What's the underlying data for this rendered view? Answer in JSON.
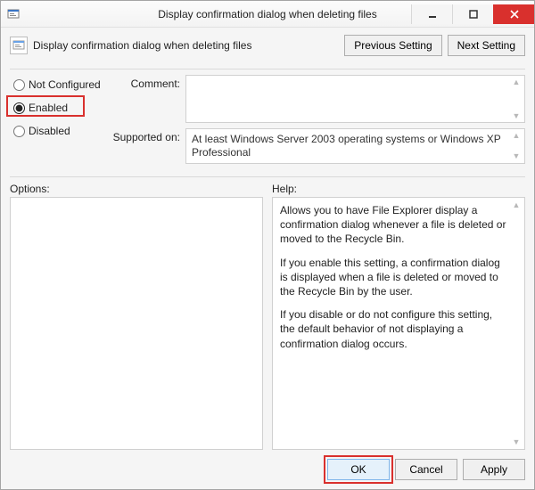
{
  "window": {
    "title": "Display confirmation dialog when deleting files"
  },
  "header": {
    "subtitle": "Display confirmation dialog when deleting files",
    "prev": "Previous Setting",
    "next": "Next Setting"
  },
  "radio": {
    "not_configured": "Not Configured",
    "enabled": "Enabled",
    "disabled": "Disabled",
    "selected": "enabled"
  },
  "fields": {
    "comment_label": "Comment:",
    "comment_value": "",
    "supported_label": "Supported on:",
    "supported_value": "At least Windows Server 2003 operating systems or Windows XP Professional"
  },
  "panes": {
    "options_label": "Options:",
    "help_label": "Help:",
    "help_p1": "Allows you to have File Explorer display a confirmation dialog whenever a file is deleted or moved to the Recycle Bin.",
    "help_p2": "If you enable this setting, a confirmation dialog is displayed when a file is deleted or moved to the Recycle Bin by the user.",
    "help_p3": "If you disable or do not configure this setting, the default behavior of not displaying a confirmation dialog occurs."
  },
  "buttons": {
    "ok": "OK",
    "cancel": "Cancel",
    "apply": "Apply"
  }
}
